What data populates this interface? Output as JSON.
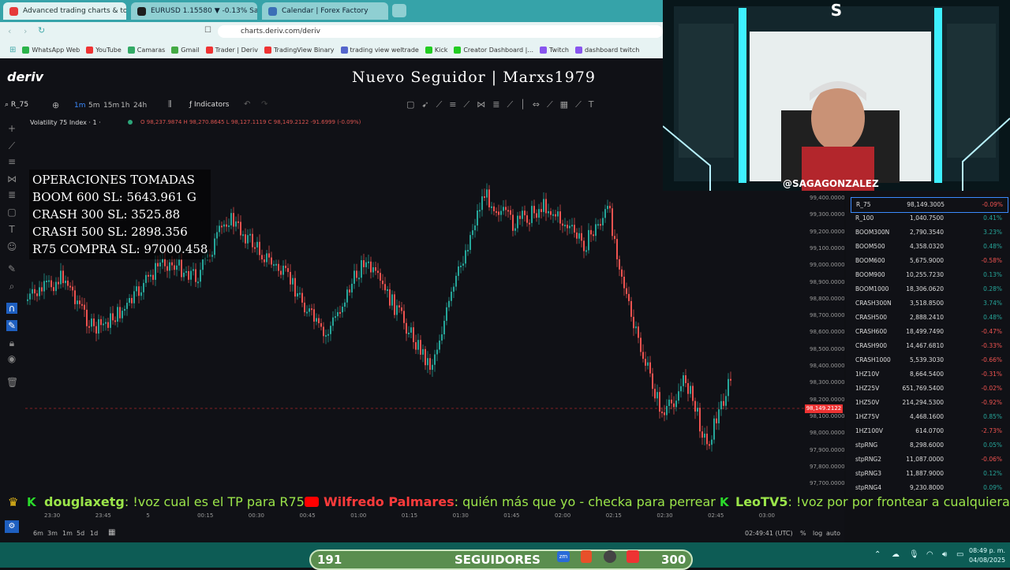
{
  "browser": {
    "tabs": [
      {
        "label": "Advanced trading charts & tools",
        "fav": "#e63a3a"
      },
      {
        "label": "EURUSD 1.15580 ▼ -0.13% Saga",
        "fav": "#1f1f1f"
      },
      {
        "label": "Calendar | Forex Factory",
        "fav": "#3b6fb6"
      }
    ],
    "url": "charts.deriv.com/deriv",
    "bookmarks": [
      "WhatsApp Web",
      "YouTube",
      "Camaras",
      "Gmail",
      "Trader | Deriv",
      "TradingView Binary",
      "trading view weltrade",
      "Kick",
      "Creator Dashboard |...",
      "Twitch",
      "dashboard twitch"
    ]
  },
  "app": {
    "brand": "deriv",
    "overlay_title": "Nuevo Seguidor | Marxs1979",
    "symbol": "R_75",
    "timeframes": [
      "1m",
      "5m",
      "15m",
      "1h",
      "24h"
    ],
    "indicators_label": "Indicators",
    "legend": "Volatility 75 Index · 1 ·",
    "ohlc": "O 98,237.9874  H 98,270.8645  L 98,127.1119  C 98,149.2122  -91.6999 (-0.09%)",
    "operations": [
      "OPERACIONES TOMADAS",
      "BOOM 600 SL: 5643.961 G",
      "CRASH 300 SL: 3525.88",
      "CRASH 500 SL: 2898.356",
      "R75 COMPRA SL: 97000.458"
    ],
    "price_ticks": [
      "99,400.0000",
      "99,300.0000",
      "99,200.0000",
      "99,100.0000",
      "99,000.0000",
      "98,900.0000",
      "98,800.0000",
      "98,700.0000",
      "98,600.0000",
      "98,500.0000",
      "98,400.0000",
      "98,300.0000",
      "98,200.0000",
      "98,100.0000",
      "98,000.0000",
      "97,900.0000",
      "97,800.0000",
      "97,700.0000"
    ],
    "price_tag": "98,149.2122",
    "time_ticks": [
      "23:30",
      "23:45",
      "5",
      "00:15",
      "00:30",
      "00:45",
      "01:00",
      "01:15",
      "01:30",
      "01:45",
      "02:00",
      "02:15",
      "02:30",
      "02:45",
      "03:00"
    ],
    "ranges": [
      "6m",
      "3m",
      "1m",
      "5d",
      "1d"
    ],
    "clock": "02:49:41 (UTC)",
    "scale_opts": [
      "%",
      "log",
      "auto"
    ]
  },
  "watchlist": [
    {
      "s": "R_75",
      "p": "98,149.3005",
      "c": "-0.09%",
      "up": false
    },
    {
      "s": "R_100",
      "p": "1,040.7500",
      "c": "0.41%",
      "up": true
    },
    {
      "s": "BOOM300N",
      "p": "2,790.3540",
      "c": "3.23%",
      "up": true
    },
    {
      "s": "BOOM500",
      "p": "4,358.0320",
      "c": "0.48%",
      "up": true
    },
    {
      "s": "BOOM600",
      "p": "5,675.9000",
      "c": "-0.58%",
      "up": false
    },
    {
      "s": "BOOM900",
      "p": "10,255.7230",
      "c": "0.13%",
      "up": true
    },
    {
      "s": "BOOM1000",
      "p": "18,306.0620",
      "c": "0.28%",
      "up": true
    },
    {
      "s": "CRASH300N",
      "p": "3,518.8500",
      "c": "3.74%",
      "up": true
    },
    {
      "s": "CRASH500",
      "p": "2,888.2410",
      "c": "0.48%",
      "up": true
    },
    {
      "s": "CRASH600",
      "p": "18,499.7490",
      "c": "-0.47%",
      "up": false
    },
    {
      "s": "CRASH900",
      "p": "14,467.6810",
      "c": "-0.33%",
      "up": false
    },
    {
      "s": "CRASH1000",
      "p": "5,539.3030",
      "c": "-0.66%",
      "up": false
    },
    {
      "s": "1HZ10V",
      "p": "8,664.5400",
      "c": "-0.31%",
      "up": false
    },
    {
      "s": "1HZ25V",
      "p": "651,769.5400",
      "c": "-0.02%",
      "up": false
    },
    {
      "s": "1HZ50V",
      "p": "214,294.5300",
      "c": "-0.92%",
      "up": false
    },
    {
      "s": "1HZ75V",
      "p": "4,468.1600",
      "c": "0.85%",
      "up": true
    },
    {
      "s": "1HZ100V",
      "p": "614.0700",
      "c": "-2.73%",
      "up": false
    },
    {
      "s": "stpRNG",
      "p": "8,298.6000",
      "c": "0.05%",
      "up": true
    },
    {
      "s": "stpRNG2",
      "p": "11,087.0000",
      "c": "-0.06%",
      "up": false
    },
    {
      "s": "stpRNG3",
      "p": "11,887.9000",
      "c": "0.12%",
      "up": true
    },
    {
      "s": "stpRNG4",
      "p": "9,230.8000",
      "c": "0.09%",
      "up": true
    }
  ],
  "stream": {
    "cam_handle": "@SAGAGONZALEZ",
    "ticker": [
      {
        "user": "douglaxetg",
        "msg": ": !voz cual es el TP para R75?",
        "color": "#9be54a"
      },
      {
        "user": "Wilfredo Palmares",
        "msg": ": quién más que yo - checka para perrear",
        "color": "#ff3b3b"
      },
      {
        "user": "LeoTV5",
        "msg": ": !voz por por frontear a cualquiera, n",
        "color": "#9be54a"
      }
    ],
    "followers_left": "191",
    "followers_label": "SEGUIDORES",
    "followers_right": "300"
  },
  "taskbar": {
    "time": "08:49 p. m.",
    "date": "04/08/2025"
  },
  "colors": {
    "up": "#26a69a",
    "down": "#ef5350"
  }
}
